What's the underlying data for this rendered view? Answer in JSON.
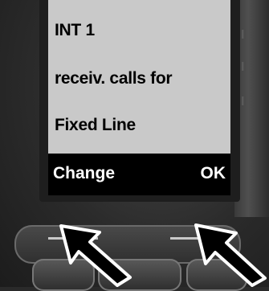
{
  "display": {
    "line1": "INT 1",
    "line2": "receiv. calls for",
    "line3": "Fixed Line",
    "softkey_left": "Change",
    "softkey_right": "OK"
  },
  "colors": {
    "screen_bg": "#c9c9c9",
    "softbar_bg": "#000000",
    "arrow_fill": "#000000",
    "arrow_outline": "#ffffff"
  },
  "icons": {
    "left_arrow": "arrow-pointing-left-softkey-icon",
    "right_arrow": "arrow-pointing-right-softkey-icon"
  }
}
